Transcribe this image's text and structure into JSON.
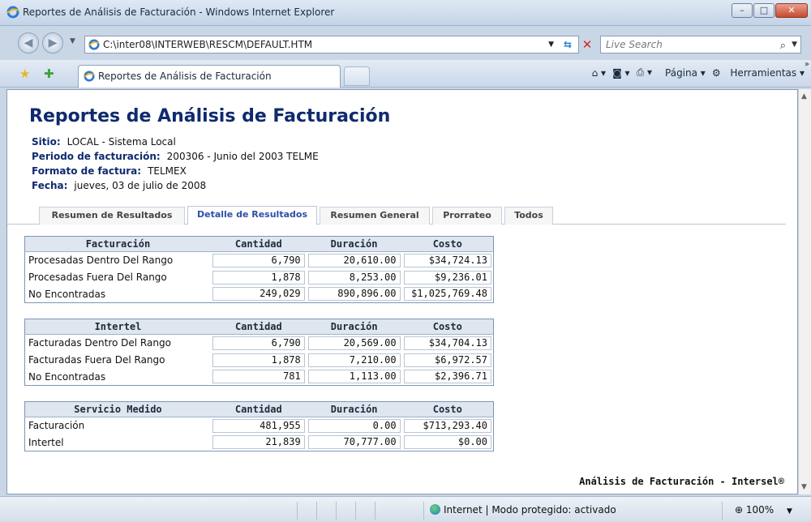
{
  "window": {
    "title": "Reportes de Análisis de Facturación - Windows Internet Explorer"
  },
  "address": {
    "url": "C:\\inter08\\INTERWEB\\RESCM\\DEFAULT.HTM",
    "search_placeholder": "Live Search"
  },
  "browser_tab": {
    "title": "Reportes de Análisis de Facturación"
  },
  "commands": {
    "page": "Página",
    "tools": "Herramientas"
  },
  "page": {
    "title": "Reportes de Análisis de Facturación",
    "info": [
      {
        "label": "Sitio:",
        "value": "LOCAL - Sistema Local"
      },
      {
        "label": "Periodo de facturación:",
        "value": "200306 - Junio del 2003 TELME"
      },
      {
        "label": "Formato de factura:",
        "value": "TELMEX"
      },
      {
        "label": "Fecha:",
        "value": "jueves, 03 de julio de 2008"
      }
    ],
    "tabs": [
      "Resumen de Resultados",
      "Detalle de Resultados",
      "Resumen General",
      "Prorrateo",
      "Todos"
    ],
    "active_tab": "Detalle de Resultados",
    "tables": [
      {
        "headers": [
          "Facturación",
          "Cantidad",
          "Duración",
          "Costo"
        ],
        "rows": [
          [
            "Procesadas Dentro Del Rango",
            "6,790",
            "20,610.00",
            "$34,724.13"
          ],
          [
            "Procesadas Fuera Del Rango",
            "1,878",
            "8,253.00",
            "$9,236.01"
          ],
          [
            "No Encontradas",
            "249,029",
            "890,896.00",
            "$1,025,769.48"
          ]
        ]
      },
      {
        "headers": [
          "Intertel",
          "Cantidad",
          "Duración",
          "Costo"
        ],
        "rows": [
          [
            "Facturadas Dentro Del Rango",
            "6,790",
            "20,569.00",
            "$34,704.13"
          ],
          [
            "Facturadas Fuera Del Rango",
            "1,878",
            "7,210.00",
            "$6,972.57"
          ],
          [
            "No Encontradas",
            "781",
            "1,113.00",
            "$2,396.71"
          ]
        ]
      },
      {
        "headers": [
          "Servicio Medido",
          "Cantidad",
          "Duración",
          "Costo"
        ],
        "rows": [
          [
            "Facturación",
            "481,955",
            "0.00",
            "$713,293.40"
          ],
          [
            "Intertel",
            "21,839",
            "70,777.00",
            "$0.00"
          ]
        ]
      }
    ],
    "footer": "Análisis de Facturación - Intersel®"
  },
  "status": {
    "zone": "Internet | Modo protegido: activado",
    "zoom": "100%"
  }
}
